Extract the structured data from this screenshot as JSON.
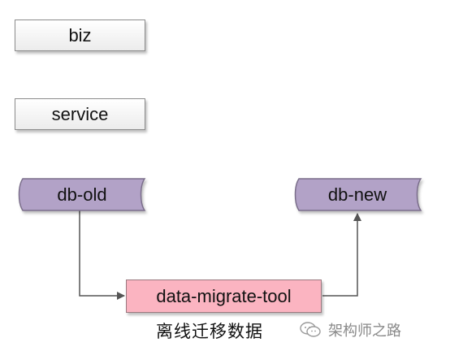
{
  "layers": {
    "biz_label": "biz",
    "service_label": "service"
  },
  "storage": {
    "old_db_label": "db-old",
    "new_db_label": "db-new"
  },
  "migration": {
    "tool_label": "data-migrate-tool",
    "caption": "离线迁移数据"
  },
  "watermark": {
    "text": "架构师之路",
    "icon": "wechat-icon"
  },
  "colors": {
    "db_fill": "#b2a2c7",
    "tool_fill": "#fbb4c1",
    "arrow": "#555555"
  }
}
